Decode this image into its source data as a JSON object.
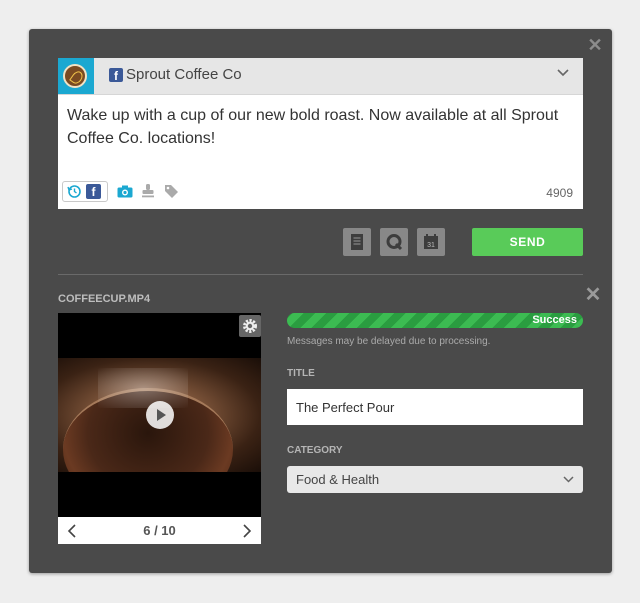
{
  "dialog": {
    "close_icon": "close-icon"
  },
  "composer": {
    "account": {
      "network": "facebook",
      "name": "Sprout Coffee Co",
      "avatar_color": "#1ba8d1"
    },
    "message": "Wake up with a cup of our new bold roast. Now available at all Sprout Coffee Co. locations!",
    "tools": [
      "history-icon",
      "facebook-icon",
      "camera-icon",
      "stamp-icon",
      "tag-icon"
    ],
    "char_count": "4909"
  },
  "actions": {
    "buttons": [
      "notes-icon",
      "queue-icon",
      "calendar-icon"
    ],
    "send_label": "SEND",
    "send_color": "#59cb59"
  },
  "upload": {
    "file_name": "COFFEECUP.MP4",
    "progress_label": "Success",
    "progress_fraction": 1.0,
    "note": "Messages may be delayed due to processing.",
    "pager": "6 / 10",
    "title_label": "TITLE",
    "title_value": "The Perfect Pour",
    "category_label": "CATEGORY",
    "category_value": "Food & Health"
  }
}
